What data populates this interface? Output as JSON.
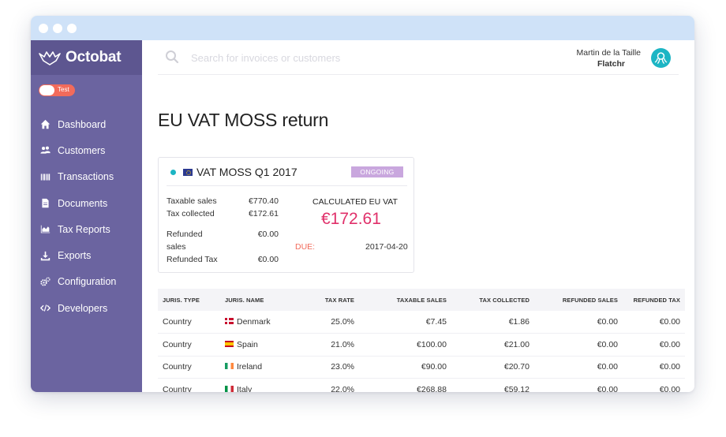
{
  "app": {
    "brand": "Octobat",
    "mode_label": "Test"
  },
  "sidebar": {
    "items": [
      {
        "label": "Dashboard",
        "icon": "home-icon"
      },
      {
        "label": "Customers",
        "icon": "users-icon"
      },
      {
        "label": "Transactions",
        "icon": "barcode-icon"
      },
      {
        "label": "Documents",
        "icon": "document-icon"
      },
      {
        "label": "Tax Reports",
        "icon": "area-chart-icon"
      },
      {
        "label": "Exports",
        "icon": "download-icon"
      },
      {
        "label": "Configuration",
        "icon": "gears-icon"
      },
      {
        "label": "Developers",
        "icon": "code-icon"
      }
    ]
  },
  "search": {
    "placeholder": "Search for invoices or customers",
    "value": ""
  },
  "user": {
    "name": "Martin de la Taille",
    "company": "Flatchr"
  },
  "page": {
    "title": "EU VAT MOSS return"
  },
  "report": {
    "title": "VAT MOSS Q1 2017",
    "status": "ONGOING",
    "taxable_sales_label": "Taxable sales",
    "taxable_sales_value": "€770.40",
    "tax_collected_label": "Tax collected",
    "tax_collected_value": "€172.61",
    "refunded_sales_label_1": "Refunded",
    "refunded_sales_label_2": "sales",
    "refunded_sales_value": "€0.00",
    "refunded_tax_label": "Refunded Tax",
    "refunded_tax_value": "€0.00",
    "calculated_label": "CALCULATED EU VAT",
    "calculated_value": "€172.61",
    "due_label": "DUE:",
    "due_value": "2017-04-20"
  },
  "table": {
    "headers": [
      "JURIS. TYPE",
      "JURIS. NAME",
      "TAX RATE",
      "TAXABLE SALES",
      "TAX COLLECTED",
      "REFUNDED SALES",
      "REFUNDED TAX"
    ],
    "rows": [
      {
        "type": "Country",
        "name": "Denmark",
        "rate": "25.0%",
        "taxable": "€7.45",
        "collected": "€1.86",
        "refunded_sales": "€0.00",
        "refunded_tax": "€0.00"
      },
      {
        "type": "Country",
        "name": "Spain",
        "rate": "21.0%",
        "taxable": "€100.00",
        "collected": "€21.00",
        "refunded_sales": "€0.00",
        "refunded_tax": "€0.00"
      },
      {
        "type": "Country",
        "name": "Ireland",
        "rate": "23.0%",
        "taxable": "€90.00",
        "collected": "€20.70",
        "refunded_sales": "€0.00",
        "refunded_tax": "€0.00"
      },
      {
        "type": "Country",
        "name": "Italy",
        "rate": "22.0%",
        "taxable": "€268.88",
        "collected": "€59.12",
        "refunded_sales": "€0.00",
        "refunded_tax": "€0.00"
      }
    ]
  },
  "colors": {
    "sidebar": "#6b64a0",
    "brand_bar": "#5d5690",
    "accent": "#1cb5c4",
    "vat_value": "#e0306a",
    "due": "#f26b5b",
    "badge": "#c9a7de"
  }
}
